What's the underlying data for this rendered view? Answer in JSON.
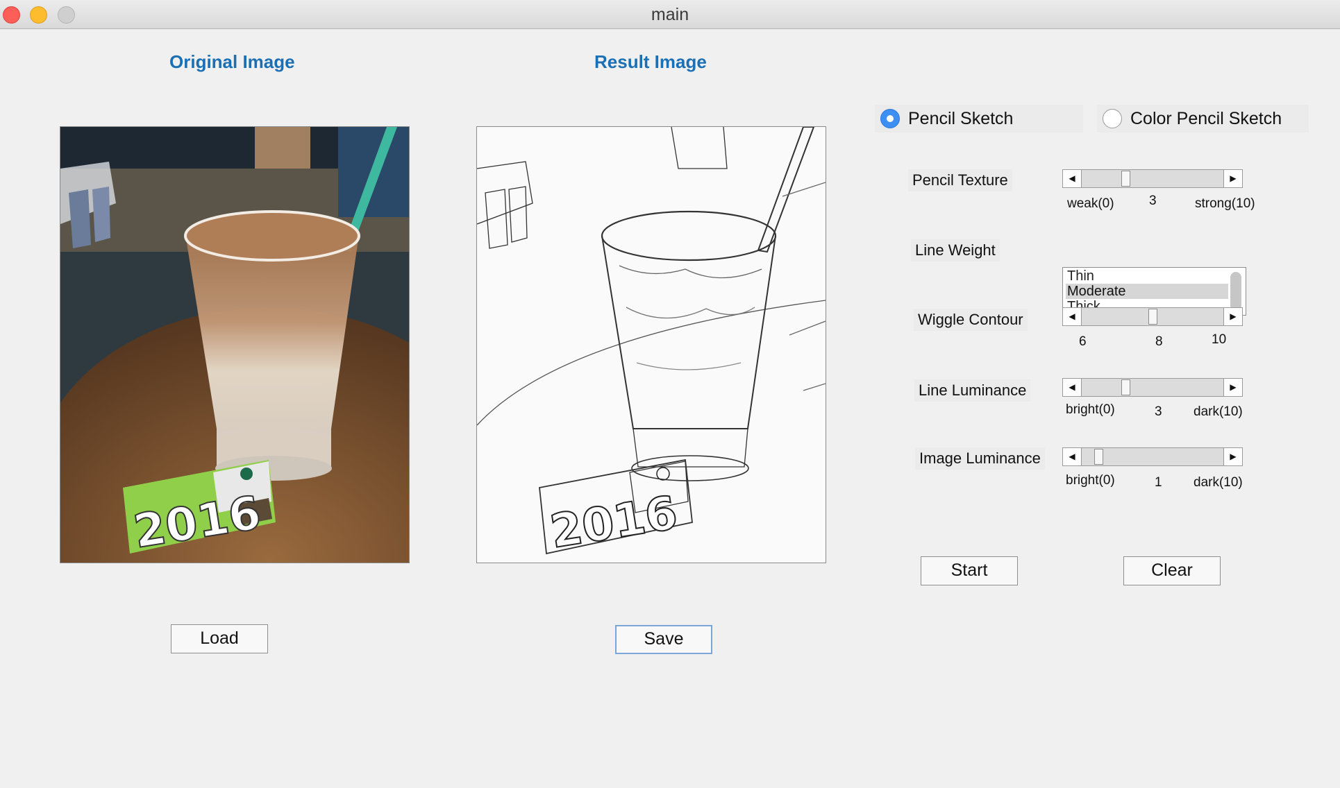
{
  "window": {
    "title": "main"
  },
  "headings": {
    "original": "Original Image",
    "result": "Result Image"
  },
  "mode": {
    "options": [
      {
        "label": "Pencil Sketch",
        "selected": true
      },
      {
        "label": "Color Pencil Sketch",
        "selected": false
      }
    ]
  },
  "params": {
    "pencil_texture": {
      "label": "Pencil Texture",
      "value": 3,
      "min": 0,
      "max": 10,
      "min_label": "weak(0)",
      "value_label": "3",
      "max_label": "strong(10)"
    },
    "line_weight": {
      "label": "Line Weight",
      "options": [
        "Thin",
        "Moderate",
        "Thick"
      ],
      "selected": "Moderate"
    },
    "wiggle_contour": {
      "label": "Wiggle Contour",
      "value": 8,
      "min": 6,
      "max": 10,
      "min_label": "6",
      "value_label": "8",
      "max_label": "10"
    },
    "line_luminance": {
      "label": "Line Luminance",
      "value": 3,
      "min": 0,
      "max": 10,
      "min_label": "bright(0)",
      "value_label": "3",
      "max_label": "dark(10)"
    },
    "image_luminance": {
      "label": "Image Luminance",
      "value": 1,
      "min": 0,
      "max": 10,
      "min_label": "bright(0)",
      "value_label": "1",
      "max_label": "dark(10)"
    }
  },
  "buttons": {
    "load": "Load",
    "save": "Save",
    "start": "Start",
    "clear": "Clear"
  },
  "icons": {
    "slider_left": "arrow-left-icon",
    "slider_right": "arrow-right-icon"
  },
  "colors": {
    "heading": "#1a6fb5",
    "radio_selected": "#3d8ff3"
  }
}
